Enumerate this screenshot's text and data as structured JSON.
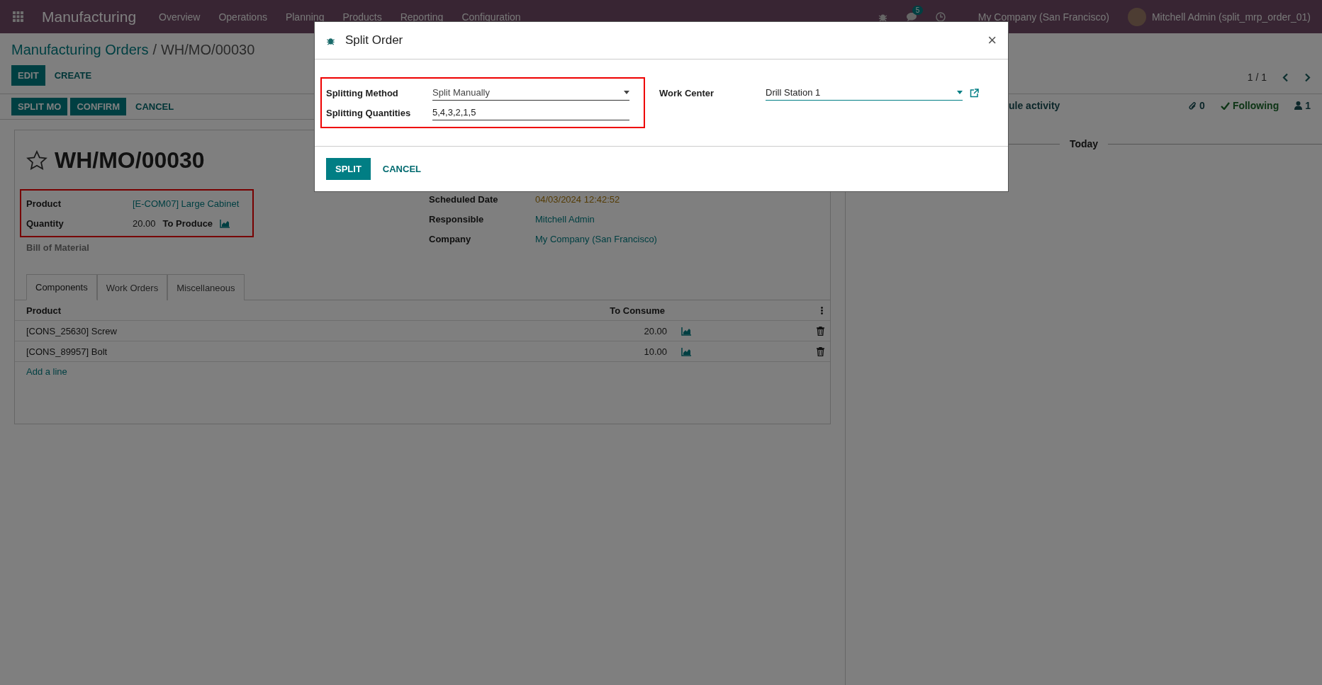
{
  "navbar": {
    "app_name": "Manufacturing",
    "menu": [
      "Overview",
      "Operations",
      "Planning",
      "Products",
      "Reporting",
      "Configuration"
    ],
    "message_count": "5",
    "company": "My Company (San Francisco)",
    "user": "Mitchell Admin (split_mrp_order_01)"
  },
  "breadcrumb": {
    "parent": "Manufacturing Orders",
    "separator": "/",
    "current": "WH/MO/00030"
  },
  "actions": [
    "EDIT",
    "CREATE"
  ],
  "pager": "1 / 1",
  "status_buttons": [
    {
      "label": "SPLIT MO",
      "kind": "primary"
    },
    {
      "label": "CONFIRM",
      "kind": "primary"
    },
    {
      "label": "CANCEL",
      "kind": "link"
    }
  ],
  "chatter": {
    "schedule": "ule activity",
    "attachments": "0",
    "following": "Following",
    "followers": "1",
    "date_separator": "Today"
  },
  "record": {
    "starred": false,
    "name": "WH/MO/00030",
    "highlighted": true,
    "left_fields": [
      {
        "label": "Product",
        "value": "[E-COM07] Large Cabinet",
        "kind": "link"
      },
      {
        "label": "Quantity",
        "value": "20.00",
        "unit": "To Produce",
        "kind": "quantity"
      },
      {
        "label": "Bill of Material",
        "kind": "empty"
      }
    ],
    "right_fields": [
      {
        "label": "Scheduled Date",
        "value": "04/03/2024 12:42:52",
        "kind": "date"
      },
      {
        "label": "Responsible",
        "value": "Mitchell Admin",
        "kind": "link"
      },
      {
        "label": "Company",
        "value": "My Company (San Francisco)",
        "kind": "link"
      }
    ]
  },
  "tabs": [
    {
      "label": "Components",
      "selected": true
    },
    {
      "label": "Work Orders",
      "selected": false
    },
    {
      "label": "Miscellaneous",
      "selected": false
    }
  ],
  "components": {
    "columns": [
      "Product",
      "To Consume"
    ],
    "rows": [
      {
        "product": "[CONS_25630] Screw",
        "to_consume": "20.00"
      },
      {
        "product": "[CONS_89957] Bolt",
        "to_consume": "10.00"
      }
    ],
    "add_line": "Add a line"
  },
  "dialog": {
    "title": "Split Order",
    "close": "×",
    "highlighted": true,
    "fields": [
      {
        "label": "Splitting Method",
        "value": "Split Manually",
        "kind": "select"
      },
      {
        "label": "Splitting Quantities",
        "value": "5,4,3,2,1,5",
        "kind": "text"
      }
    ],
    "work_center": {
      "label": "Work Center",
      "value": "Drill Station 1"
    },
    "buttons": [
      {
        "label": "SPLIT",
        "kind": "primary"
      },
      {
        "label": "CANCEL",
        "kind": "link"
      }
    ]
  }
}
